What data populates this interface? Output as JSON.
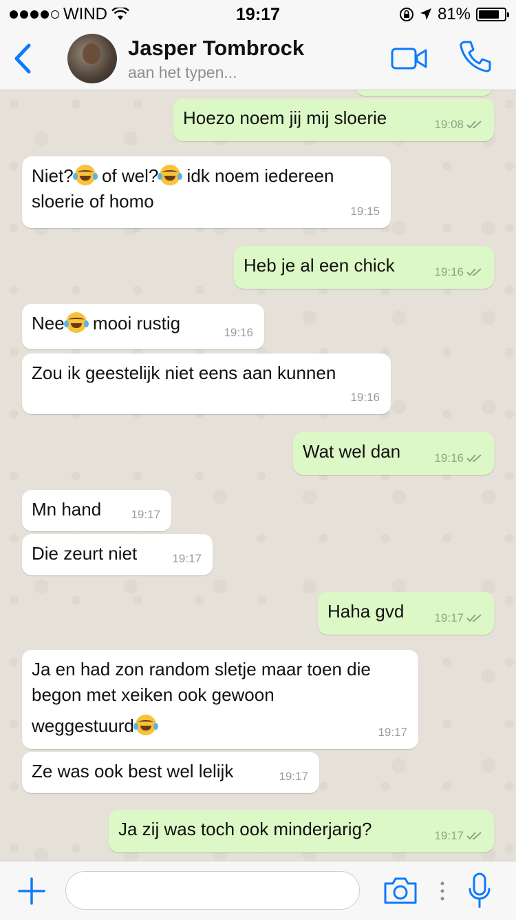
{
  "status_bar": {
    "carrier": "WIND",
    "time": "19:17",
    "battery": "81%",
    "battery_level": 0.81,
    "signal_bars_filled": 4,
    "signal_bars_total": 5
  },
  "header": {
    "contact_name": "Jasper Tombrock",
    "contact_status": "aan het typen...",
    "accent_color": "#0a7aff",
    "icons": {
      "back": "chevron-left-icon",
      "video": "video-camera-icon",
      "call": "phone-icon"
    }
  },
  "messages": [
    {
      "dir": "out",
      "parts": [
        "Hoezo noem jij mij sloerie"
      ],
      "time": "19:08",
      "read": true
    },
    {
      "dir": "in",
      "parts": [
        "Niet?",
        "of wel?",
        " idk noem iedereen",
        "sloerie of homo"
      ],
      "time": "19:15"
    },
    {
      "dir": "out",
      "parts": [
        "Heb je al een chick"
      ],
      "time": "19:16",
      "read": true
    },
    {
      "dir": "in",
      "parts": [
        "Nee",
        " mooi rustig"
      ],
      "time": "19:16"
    },
    {
      "dir": "in",
      "parts": [
        "Zou ik geestelijk niet eens aan kunnen"
      ],
      "time": "19:16"
    },
    {
      "dir": "out",
      "parts": [
        "Wat wel dan"
      ],
      "time": "19:16",
      "read": true
    },
    {
      "dir": "in",
      "parts": [
        "Mn hand"
      ],
      "time": "19:17"
    },
    {
      "dir": "in",
      "parts": [
        "Die zeurt niet"
      ],
      "time": "19:17"
    },
    {
      "dir": "out",
      "parts": [
        "Haha gvd"
      ],
      "time": "19:17",
      "read": true
    },
    {
      "dir": "in",
      "parts": [
        "Ja en had zon random sletje maar toen die",
        "begon met xeiken ook gewoon",
        "weggestuurd"
      ],
      "time": "19:17"
    },
    {
      "dir": "in",
      "parts": [
        "Ze was ook best wel lelijk"
      ],
      "time": "19:17"
    },
    {
      "dir": "out",
      "parts": [
        "Ja zij was toch ook minderjarig?"
      ],
      "time": "19:17",
      "read": true
    }
  ],
  "emoji": "face-with-tears-of-joy-icon",
  "input_bar": {
    "placeholder": "",
    "icons": {
      "add": "plus-icon",
      "camera": "camera-icon",
      "more": "more-vertical-icon",
      "mic": "microphone-icon"
    }
  },
  "colors": {
    "incoming_bubble": "#ffffff",
    "outgoing_bubble": "#dcf8c6",
    "chat_background": "#e6e1d8",
    "read_ticks": "#8fa486"
  }
}
